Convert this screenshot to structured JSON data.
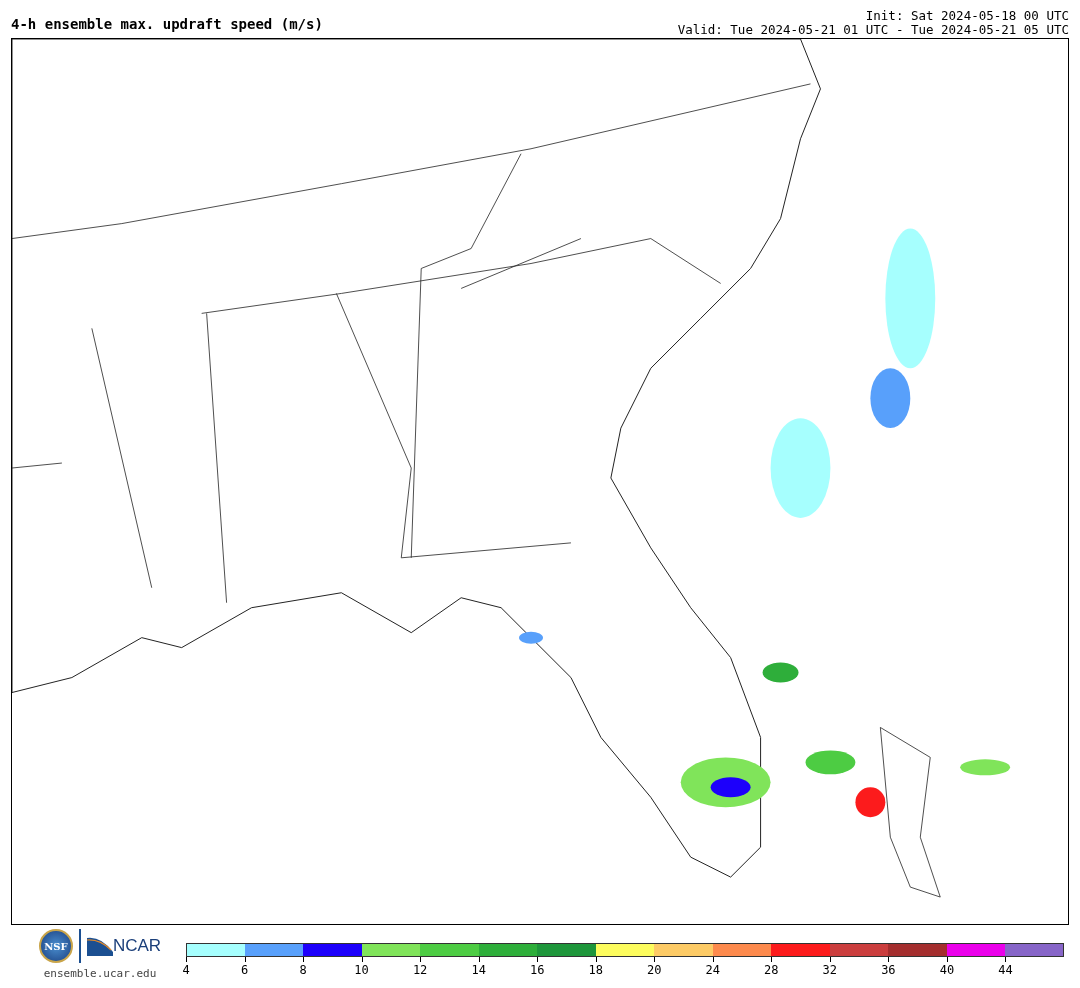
{
  "title": "4-h ensemble max. updraft speed (m/s)",
  "init": "Init: Sat 2024-05-18 00 UTC",
  "valid": "Valid: Tue 2024-05-21 01 UTC - Tue 2024-05-21 05 UTC",
  "logos": {
    "nsf": "NSF",
    "ncar": "NCAR",
    "site": "ensemble.ucar.edu"
  },
  "colorbar": [
    {
      "label": "4",
      "color": "#a6fffe"
    },
    {
      "label": "6",
      "color": "#58a0fb"
    },
    {
      "label": "8",
      "color": "#1d00fb"
    },
    {
      "label": "10",
      "color": "#80e45a"
    },
    {
      "label": "12",
      "color": "#4dcc43"
    },
    {
      "label": "14",
      "color": "#2eae3a"
    },
    {
      "label": "16",
      "color": "#1e963b"
    },
    {
      "label": "18",
      "color": "#fdfd5e"
    },
    {
      "label": "20",
      "color": "#fdcb66"
    },
    {
      "label": "24",
      "color": "#fd8a4d"
    },
    {
      "label": "28",
      "color": "#fc1b1c"
    },
    {
      "label": "32",
      "color": "#cb3e3e"
    },
    {
      "label": "36",
      "color": "#a42e2e"
    },
    {
      "label": "40",
      "color": "#ea00ea"
    },
    {
      "label": "44",
      "color": "#8765c8"
    }
  ]
}
